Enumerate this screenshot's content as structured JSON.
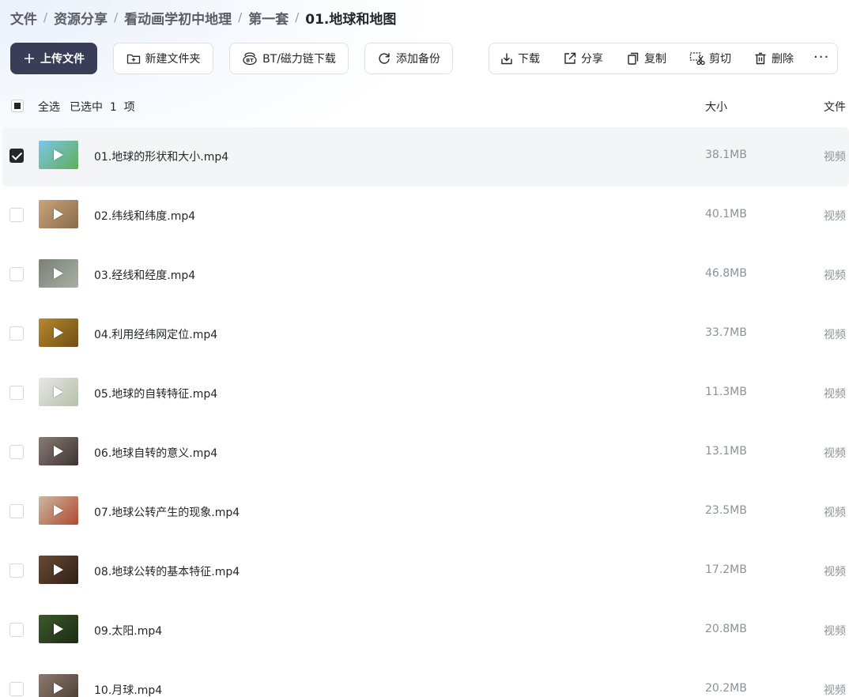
{
  "breadcrumb": [
    {
      "label": "文件"
    },
    {
      "label": "资源分享"
    },
    {
      "label": "看动画学初中地理"
    },
    {
      "label": "第一套"
    },
    {
      "label": "01.地球和地图"
    }
  ],
  "toolbar": {
    "upload_label": "上传文件",
    "new_folder_label": "新建文件夹",
    "bt_label": "BT/磁力链下载",
    "backup_label": "添加备份",
    "download_label": "下载",
    "share_label": "分享",
    "copy_label": "复制",
    "cut_label": "剪切",
    "delete_label": "删除",
    "more_label": "···"
  },
  "list_header": {
    "select_all": "全选",
    "selected_text": "已选中  1  项",
    "size": "大小",
    "type": "文件"
  },
  "files": [
    {
      "name": "01.地球的形状和大小.mp4",
      "size": "38.1MB",
      "type": "视频",
      "selected": true,
      "thumb_colors": [
        "#7cc6e8",
        "#5fae5a"
      ]
    },
    {
      "name": "02.纬线和纬度.mp4",
      "size": "40.1MB",
      "type": "视频",
      "selected": false,
      "thumb_colors": [
        "#c9a57a",
        "#8a6a4a"
      ]
    },
    {
      "name": "03.经线和经度.mp4",
      "size": "46.8MB",
      "type": "视频",
      "selected": false,
      "thumb_colors": [
        "#7a8078",
        "#a8b0a4"
      ]
    },
    {
      "name": "04.利用经纬网定位.mp4",
      "size": "33.7MB",
      "type": "视频",
      "selected": false,
      "thumb_colors": [
        "#b8882c",
        "#6e4f18"
      ]
    },
    {
      "name": "05.地球的自转特征.mp4",
      "size": "11.3MB",
      "type": "视频",
      "selected": false,
      "thumb_colors": [
        "#e6e6e6",
        "#b5c2a8"
      ]
    },
    {
      "name": "06.地球自转的意义.mp4",
      "size": "13.1MB",
      "type": "视频",
      "selected": false,
      "thumb_colors": [
        "#8a7a74",
        "#3e3432"
      ]
    },
    {
      "name": "07.地球公转产生的现象.mp4",
      "size": "23.5MB",
      "type": "视频",
      "selected": false,
      "thumb_colors": [
        "#c8b8a4",
        "#b24a2e"
      ]
    },
    {
      "name": "08.地球公转的基本特征.mp4",
      "size": "17.2MB",
      "type": "视频",
      "selected": false,
      "thumb_colors": [
        "#6a4a32",
        "#2e2018"
      ]
    },
    {
      "name": "09.太阳.mp4",
      "size": "20.8MB",
      "type": "视频",
      "selected": false,
      "thumb_colors": [
        "#3a5a2a",
        "#1e2a14"
      ]
    },
    {
      "name": "10.月球.mp4",
      "size": "20.2MB",
      "type": "视频",
      "selected": false,
      "thumb_colors": [
        "#8e7a6e",
        "#4a3c34"
      ]
    }
  ],
  "icons": {
    "upload": "plus-icon",
    "new_folder": "folder-plus-icon",
    "bt": "bt-icon",
    "backup": "sync-icon",
    "download": "download-icon",
    "share": "share-icon",
    "copy": "copy-icon",
    "cut": "scissors-icon",
    "delete": "trash-icon",
    "more": "more-icon",
    "play": "play-icon"
  },
  "colors": {
    "primary_button": "#3a3d56",
    "text": "#25262b",
    "muted": "#8d9099",
    "selected_row": "#f4f5f7"
  }
}
